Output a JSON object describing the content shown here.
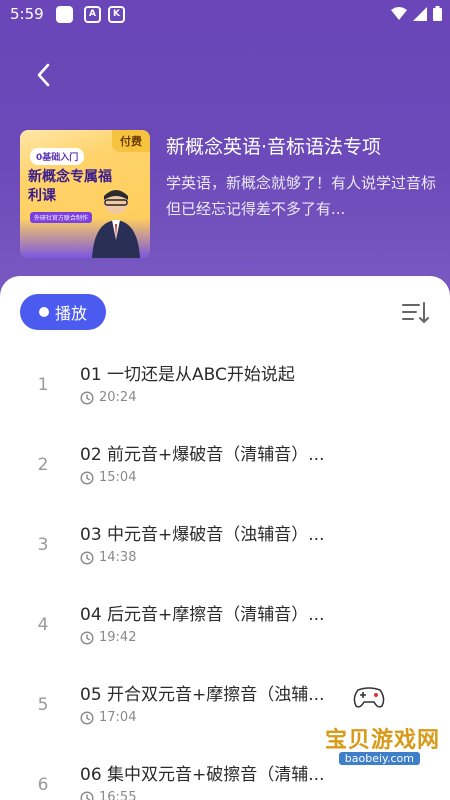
{
  "status_bar": {
    "time": "5:59",
    "app_icons": [
      "app-square-icon",
      "a-letter-icon",
      "k-letter-icon"
    ],
    "app_letters": [
      "",
      "A",
      "K"
    ]
  },
  "header": {
    "background_color": "#6a46b8",
    "back_icon": "chevron-left-icon",
    "cover": {
      "tag": "付费",
      "pill": "0基础入门",
      "title": "新概念专属福利课",
      "sub": "外研社官方联合制作"
    },
    "title": "新概念英语·音标语法专项",
    "description": "学英语，新概念就够了！有人说学过音标但已经忘记得差不多了有..."
  },
  "controls": {
    "play_label": "播放",
    "accent_color": "#4b5bf0",
    "sort_icon": "sort-icon"
  },
  "episodes": [
    {
      "index": "1",
      "title": "01 一切还是从ABC开始说起",
      "duration": "20:24"
    },
    {
      "index": "2",
      "title": "02 前元音+爆破音（清辅音）...",
      "duration": "15:04"
    },
    {
      "index": "3",
      "title": "03 中元音+爆破音（浊辅音）...",
      "duration": "14:38"
    },
    {
      "index": "4",
      "title": "04 后元音+摩擦音（清辅音）...",
      "duration": "19:42"
    },
    {
      "index": "5",
      "title": "05 开合双元音+摩擦音（浊辅...",
      "duration": "17:04"
    },
    {
      "index": "6",
      "title": "06 集中双元音+破擦音（清辅...",
      "duration": "16:55"
    }
  ],
  "watermark": {
    "title": "宝贝游戏网",
    "url": "baobeiy.com"
  }
}
